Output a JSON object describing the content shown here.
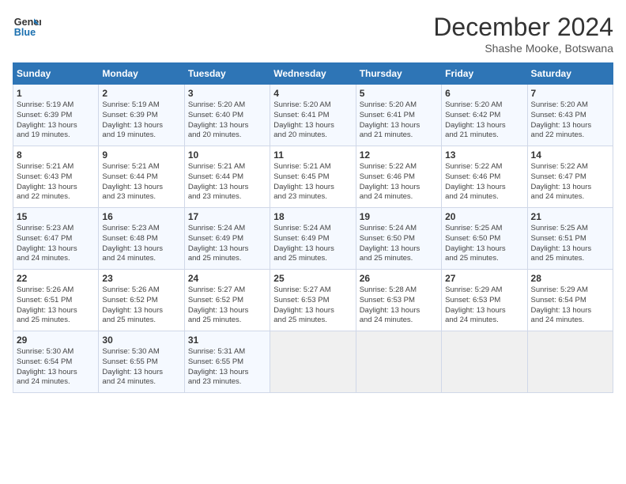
{
  "logo": {
    "line1": "General",
    "line2": "Blue"
  },
  "title": "December 2024",
  "subtitle": "Shashe Mooke, Botswana",
  "days_header": [
    "Sunday",
    "Monday",
    "Tuesday",
    "Wednesday",
    "Thursday",
    "Friday",
    "Saturday"
  ],
  "weeks": [
    [
      {
        "day": "1",
        "detail": "Sunrise: 5:19 AM\nSunset: 6:39 PM\nDaylight: 13 hours\nand 19 minutes."
      },
      {
        "day": "2",
        "detail": "Sunrise: 5:19 AM\nSunset: 6:39 PM\nDaylight: 13 hours\nand 19 minutes."
      },
      {
        "day": "3",
        "detail": "Sunrise: 5:20 AM\nSunset: 6:40 PM\nDaylight: 13 hours\nand 20 minutes."
      },
      {
        "day": "4",
        "detail": "Sunrise: 5:20 AM\nSunset: 6:41 PM\nDaylight: 13 hours\nand 20 minutes."
      },
      {
        "day": "5",
        "detail": "Sunrise: 5:20 AM\nSunset: 6:41 PM\nDaylight: 13 hours\nand 21 minutes."
      },
      {
        "day": "6",
        "detail": "Sunrise: 5:20 AM\nSunset: 6:42 PM\nDaylight: 13 hours\nand 21 minutes."
      },
      {
        "day": "7",
        "detail": "Sunrise: 5:20 AM\nSunset: 6:43 PM\nDaylight: 13 hours\nand 22 minutes."
      }
    ],
    [
      {
        "day": "8",
        "detail": "Sunrise: 5:21 AM\nSunset: 6:43 PM\nDaylight: 13 hours\nand 22 minutes."
      },
      {
        "day": "9",
        "detail": "Sunrise: 5:21 AM\nSunset: 6:44 PM\nDaylight: 13 hours\nand 23 minutes."
      },
      {
        "day": "10",
        "detail": "Sunrise: 5:21 AM\nSunset: 6:44 PM\nDaylight: 13 hours\nand 23 minutes."
      },
      {
        "day": "11",
        "detail": "Sunrise: 5:21 AM\nSunset: 6:45 PM\nDaylight: 13 hours\nand 23 minutes."
      },
      {
        "day": "12",
        "detail": "Sunrise: 5:22 AM\nSunset: 6:46 PM\nDaylight: 13 hours\nand 24 minutes."
      },
      {
        "day": "13",
        "detail": "Sunrise: 5:22 AM\nSunset: 6:46 PM\nDaylight: 13 hours\nand 24 minutes."
      },
      {
        "day": "14",
        "detail": "Sunrise: 5:22 AM\nSunset: 6:47 PM\nDaylight: 13 hours\nand 24 minutes."
      }
    ],
    [
      {
        "day": "15",
        "detail": "Sunrise: 5:23 AM\nSunset: 6:47 PM\nDaylight: 13 hours\nand 24 minutes."
      },
      {
        "day": "16",
        "detail": "Sunrise: 5:23 AM\nSunset: 6:48 PM\nDaylight: 13 hours\nand 24 minutes."
      },
      {
        "day": "17",
        "detail": "Sunrise: 5:24 AM\nSunset: 6:49 PM\nDaylight: 13 hours\nand 25 minutes."
      },
      {
        "day": "18",
        "detail": "Sunrise: 5:24 AM\nSunset: 6:49 PM\nDaylight: 13 hours\nand 25 minutes."
      },
      {
        "day": "19",
        "detail": "Sunrise: 5:24 AM\nSunset: 6:50 PM\nDaylight: 13 hours\nand 25 minutes."
      },
      {
        "day": "20",
        "detail": "Sunrise: 5:25 AM\nSunset: 6:50 PM\nDaylight: 13 hours\nand 25 minutes."
      },
      {
        "day": "21",
        "detail": "Sunrise: 5:25 AM\nSunset: 6:51 PM\nDaylight: 13 hours\nand 25 minutes."
      }
    ],
    [
      {
        "day": "22",
        "detail": "Sunrise: 5:26 AM\nSunset: 6:51 PM\nDaylight: 13 hours\nand 25 minutes."
      },
      {
        "day": "23",
        "detail": "Sunrise: 5:26 AM\nSunset: 6:52 PM\nDaylight: 13 hours\nand 25 minutes."
      },
      {
        "day": "24",
        "detail": "Sunrise: 5:27 AM\nSunset: 6:52 PM\nDaylight: 13 hours\nand 25 minutes."
      },
      {
        "day": "25",
        "detail": "Sunrise: 5:27 AM\nSunset: 6:53 PM\nDaylight: 13 hours\nand 25 minutes."
      },
      {
        "day": "26",
        "detail": "Sunrise: 5:28 AM\nSunset: 6:53 PM\nDaylight: 13 hours\nand 24 minutes."
      },
      {
        "day": "27",
        "detail": "Sunrise: 5:29 AM\nSunset: 6:53 PM\nDaylight: 13 hours\nand 24 minutes."
      },
      {
        "day": "28",
        "detail": "Sunrise: 5:29 AM\nSunset: 6:54 PM\nDaylight: 13 hours\nand 24 minutes."
      }
    ],
    [
      {
        "day": "29",
        "detail": "Sunrise: 5:30 AM\nSunset: 6:54 PM\nDaylight: 13 hours\nand 24 minutes."
      },
      {
        "day": "30",
        "detail": "Sunrise: 5:30 AM\nSunset: 6:55 PM\nDaylight: 13 hours\nand 24 minutes."
      },
      {
        "day": "31",
        "detail": "Sunrise: 5:31 AM\nSunset: 6:55 PM\nDaylight: 13 hours\nand 23 minutes."
      },
      {
        "day": "",
        "detail": ""
      },
      {
        "day": "",
        "detail": ""
      },
      {
        "day": "",
        "detail": ""
      },
      {
        "day": "",
        "detail": ""
      }
    ]
  ]
}
